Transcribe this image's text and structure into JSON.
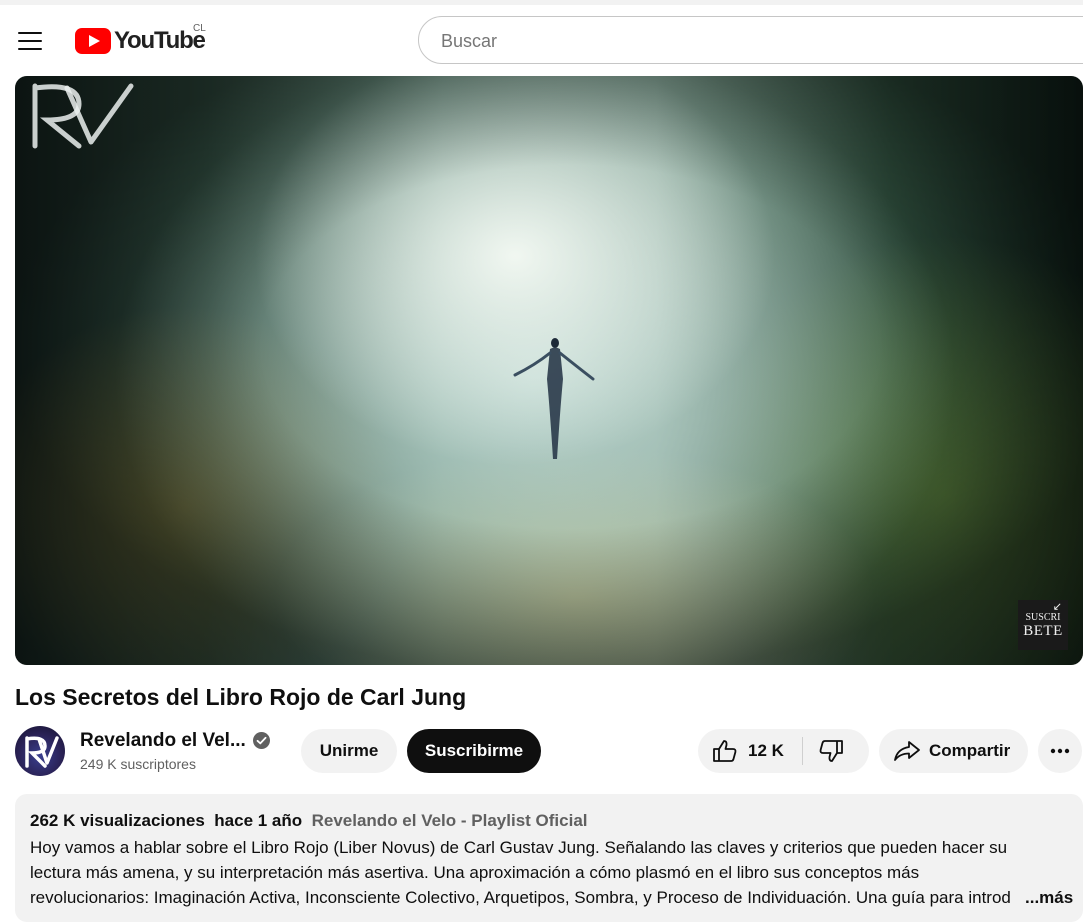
{
  "masthead": {
    "logo_text": "YouTube",
    "country_code": "CL",
    "search_placeholder": "Buscar",
    "icons": {
      "menu": "hamburger-menu-icon",
      "logo": "youtube-logo-icon"
    }
  },
  "player": {
    "watermark_logo": "RV",
    "subscribe_badge": {
      "line1": "SUSCRI",
      "line2": "BETE"
    }
  },
  "video": {
    "title": "Los Secretos del Libro Rojo de Carl Jung"
  },
  "channel": {
    "name": "Revelando el Vel...",
    "subscribers": "249 K suscriptores",
    "verified_icon": "verified-check-icon"
  },
  "actions": {
    "join_label": "Unirme",
    "subscribe_label": "Suscribirme",
    "like_count": "12 K",
    "share_label": "Compartir",
    "icons": {
      "like": "thumbs-up-icon",
      "dislike": "thumbs-down-icon",
      "share": "share-arrow-icon",
      "more": "more-horizontal-icon"
    }
  },
  "description": {
    "views": "262 K visualizaciones",
    "date": "hace 1 año",
    "playlist": "Revelando el Velo - Playlist Oficial",
    "lines": [
      "Hoy vamos a hablar sobre el Libro Rojo (Liber Novus) de Carl Gustav Jung. Señalando las claves y criterios que pueden hacer su",
      "lectura más amena, y su interpretación más asertiva. Una aproximación a cómo plasmó en el libro sus conceptos más",
      "revolucionarios: Imaginación Activa, Inconsciente Colectivo, Arquetipos, Sombra, y Proceso de Individuación. Una guía para introducirse"
    ],
    "more_label": "...más"
  },
  "colors": {
    "brand_red": "#ff0000",
    "text_primary": "#0f0f0f",
    "text_secondary": "#606060",
    "chip_bg": "#f2f2f2",
    "subscribe_bg": "#0f0f0f"
  }
}
